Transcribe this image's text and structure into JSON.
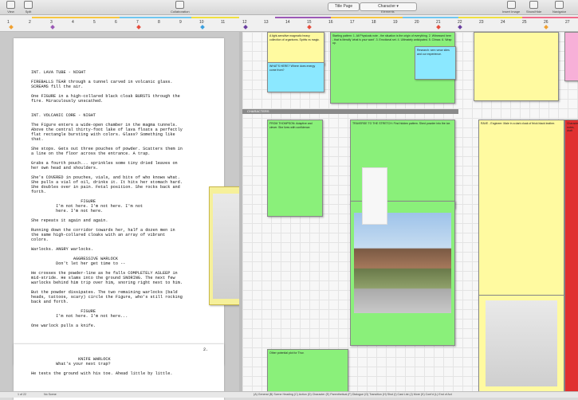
{
  "toolbar": {
    "view": "View",
    "split": "Split",
    "collaboration": "Collaboration",
    "title_page": "Title Page",
    "elements_label": "Elements",
    "element_value": "Character",
    "insert_image": "Insert Image",
    "show_hide": "Show/Hide",
    "navigator": "Navigator"
  },
  "ruler": {
    "numbers": [
      "1",
      "2",
      "3",
      "4",
      "5",
      "6",
      "7",
      "8",
      "9",
      "10",
      "11",
      "12",
      "13",
      "14",
      "15",
      "16",
      "17",
      "18",
      "19",
      "20",
      "21",
      "22",
      "23",
      "24",
      "25",
      "26",
      "27"
    ]
  },
  "script": {
    "page1": "INT. LAVA TUBE - NIGHT\n\nFIREBALLS TEAR through a tunnel carved in volcanic glass.\nSCREAMS fill the air.\n\nOne FIGURE in a high-collared black cloak BURSTS through the\nfire. Miraculously unscathed.\n\n\nINT. VOLCANIC CORE - NIGHT\n\nThe Figure enters a wide-open chamber in the magma tunnels.\nAbove the central thirty-foot lake of lava floats a perfectly\nflat rectangle bursting with colors. Glass? Something like\nthat.\n\nShe stops. Gets out three pouches of powder. Scatters them in\na line on the floor across the entrance. A trap.\n\nGrabs a fourth pouch... sprinkles some tiny dried leaves on\nher own head and shoulders.\n\nShe's COVERED in pouches, vials, and bits of who knows what.\nShe pulls a vial of oil, drinks it. It hits her stomach hard.\nShe doubles over in pain. Fetal position. She rocks back and\nforth.\n\n                    FIGURE\n          I'm not here. I'm not here. I'm not\n          here. I'm not here.\n\nShe repeats it again and again.\n\nRunning down the corridor towards her, half a dozen men in\nthe same high-collared cloaks with an array of vibrant\ncolors.\n\nWarlocks. ANGRY warlocks.\n\n                 AGGRESSIVE WARLOCK\n          Don't let her get time to --\n\nHe crosses the powder-line as he falls COMPLETELY ASLEEP in\nmid-stride. He slams into the ground SNORING. The next few\nwarlocks behind him trip over him, snoring right next to him.\n\nBut the powder dissipates. The two remaining warlocks (bald\nheads, tattoos, scary) circle the Figure, who's still rocking\nback and forth.\n\n                    FIGURE\n          I'm not here. I'm not here...\n\nOne warlock pulls a knife.",
    "page_number": "2.",
    "page2": "                   KNIFE WARLOCK\n          What's your next trap?\n\nHe tests the ground with his toe. Ahead little by little."
  },
  "board": {
    "section_label": "CHARACTERS",
    "notes": [
      "A light-sensitive magmatic heavy collection of organisms. Spirits vs magic.",
      "WHAT'S HERE? Where does energy come from?",
      "Starting pattern: 1. All Physicals note - the situation is the origin of everything. 2. Witnessed here - that is literally 'what is your want'. 3. Emotional set. 4. Ultimately anticipated. 5. Climax. 6. Wrap up.",
      "Research: see rumor sites and our experience.",
      "FROM THOMPSON: Adaptive and clever. She lives with confidence.",
      "TRAVERSE TO THE STRETCH: Find hidden pattern. Shed powder into the ice.",
      "RAVE - Engineer: Male in a dark cloak of thick black leather.",
      "Other potential plot for Thor.",
      "Character notes, draft"
    ]
  },
  "status": {
    "left": "1 of 22",
    "mid": "No Scene",
    "bottom": "(A) General  (B) Scene Heading  (C) Action  (D) Character  (E) Parenthetical  (F) Dialogue  (G) Transition  (H) Shot  (I) Cast List  (J) More  (K) Cont'd  (L) End of Act"
  }
}
